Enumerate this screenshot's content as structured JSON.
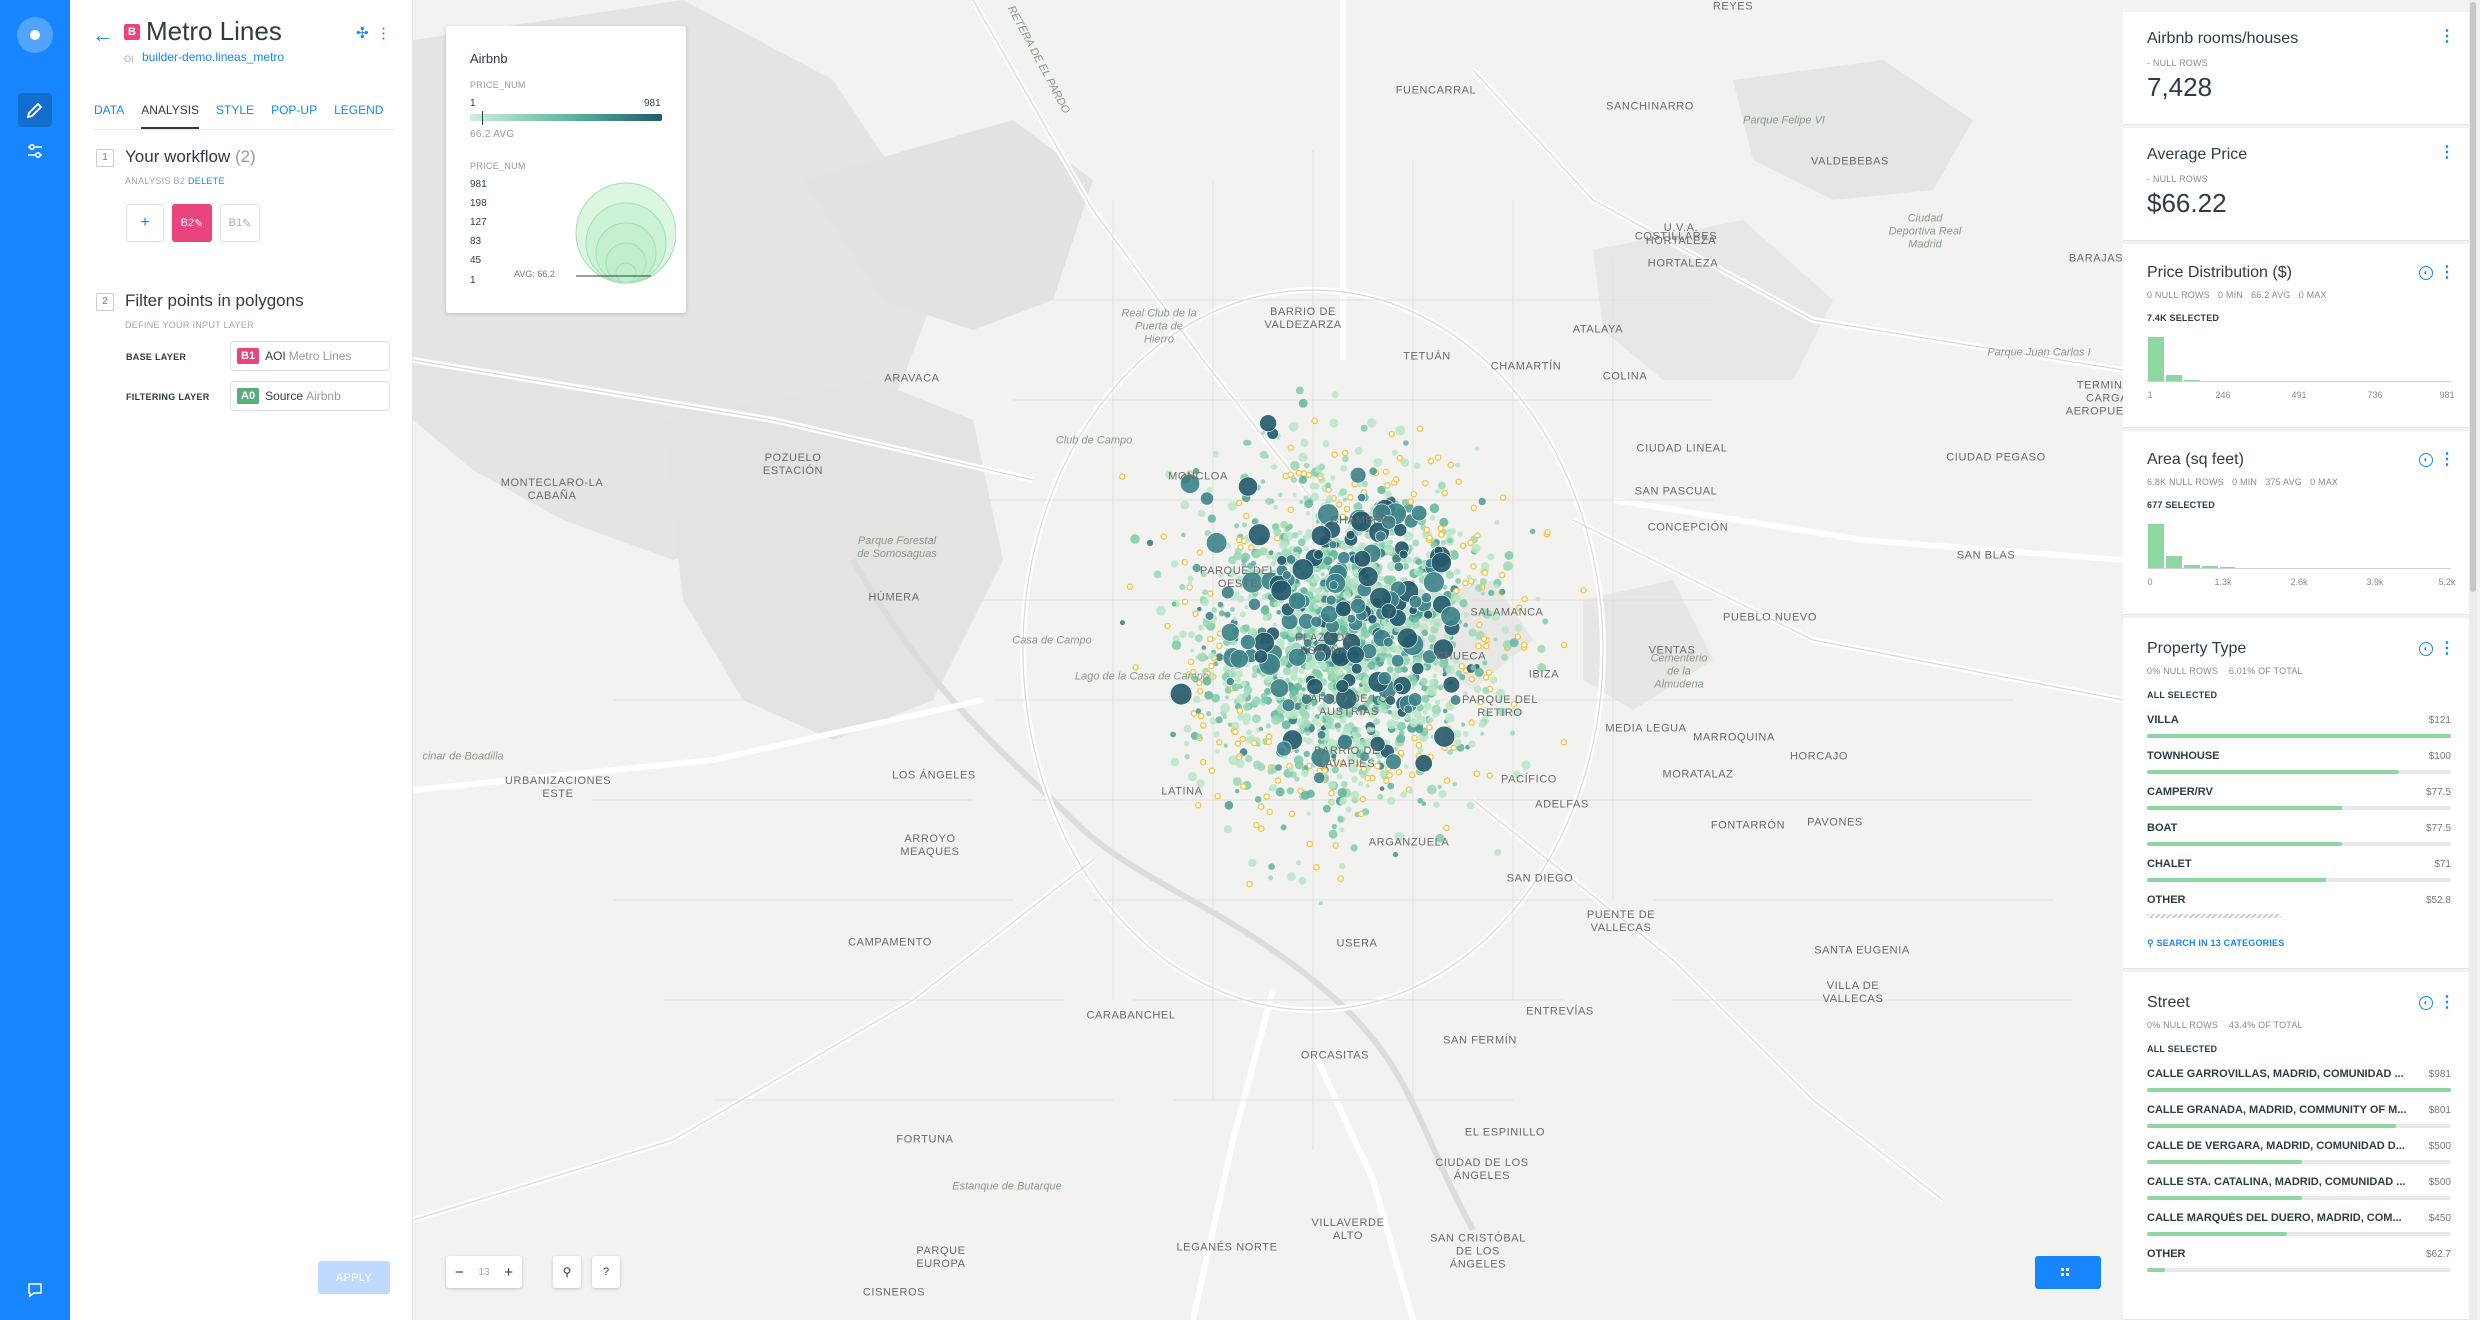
{
  "panel": {
    "badge": "B",
    "title": "Metro Lines",
    "subtitle_prefix": "OI",
    "subtitle": "builder-demo.lineas_metro",
    "tabs": [
      "DATA",
      "ANALYSIS",
      "STYLE",
      "POP-UP",
      "LEGEND"
    ],
    "selected_tab": "ANALYSIS",
    "workflow": {
      "step": "1",
      "title": "Your workflow",
      "count": "(2)",
      "analysis_label": "ANALYSIS B2",
      "delete_label": "DELETE",
      "add_label": "+",
      "node_b2": "B2",
      "node_b1": "B1"
    },
    "filter": {
      "step": "2",
      "title": "Filter points in polygons",
      "subtitle": "DEFINE YOUR INPUT LAYER",
      "base_layer_label": "BASE LAYER",
      "base_badge": "B1",
      "base_name": "AOI",
      "base_source": "Metro Lines",
      "filter_layer_label": "FILTERING LAYER",
      "filter_badge": "A0",
      "filter_name": "Source",
      "filter_source": "Airbnb"
    },
    "apply_label": "APPLY"
  },
  "legend": {
    "title": "Airbnb",
    "field1": "PRICE_NUM",
    "min": "1",
    "max": "981",
    "avg_label": "66.2 AVG",
    "field2": "PRICE_NUM",
    "sizes": [
      "981",
      "198",
      "127",
      "83",
      "45",
      "1"
    ],
    "bubble_avg": "AVG: 66.2"
  },
  "map_controls": {
    "zoom": "13",
    "zoom_out": "−",
    "zoom_in": "+",
    "help": "?"
  },
  "map_labels": [
    {
      "t": "REYES"
    },
    {
      "t": "FUENCARRAL"
    },
    {
      "t": "SANCHINARRO"
    },
    {
      "t": "VALDEBEBAS"
    },
    {
      "t": "COSTILLARES"
    },
    {
      "t": "U.V.A.\nHORTALEZA"
    },
    {
      "t": "HORTALEZA"
    },
    {
      "t": "BARRIO DE\nVALDEZARZA"
    },
    {
      "t": "ATALAYA"
    },
    {
      "t": "TETUÁN"
    },
    {
      "t": "CHAMARTÍN"
    },
    {
      "t": "COLINA"
    },
    {
      "t": "ARAVACA"
    },
    {
      "t": "POZUELO\nESTACIÓN"
    },
    {
      "t": "MONCLOA"
    },
    {
      "t": "CIUDAD LINEAL"
    },
    {
      "t": "CIUDAD PEGASO"
    },
    {
      "t": "TERMINAL\nCARGA\nAEROPUERTO"
    },
    {
      "t": "BARAJAS"
    },
    {
      "t": "MONTECLARO-LA\nCABAÑA"
    },
    {
      "t": "SAN PASCUAL"
    },
    {
      "t": "CHAMBERÍ"
    },
    {
      "t": "CONCEPCIÓN"
    },
    {
      "t": "SAN BLAS"
    },
    {
      "t": "PARQUE DEL\nOESTE"
    },
    {
      "t": "HÚMERA"
    },
    {
      "t": "SALAMANCA"
    },
    {
      "t": "PUEBLO NUEVO"
    },
    {
      "t": "PLAZA DE\nESPAÑA"
    },
    {
      "t": "CHUECA"
    },
    {
      "t": "VENTAS"
    },
    {
      "t": "IBIZA"
    },
    {
      "t": "BARRIO DE LOS\nAUSTRIAS"
    },
    {
      "t": "PARQUE DEL\nRETIRO"
    },
    {
      "t": "MEDIA LEGUA"
    },
    {
      "t": "MARROQUINA"
    },
    {
      "t": "HORCAJO"
    },
    {
      "t": "BARRIO DE\nLAVAPIÉS"
    },
    {
      "t": "URBANIZACIONES\nESTE"
    },
    {
      "t": "LOS ÁNGELES"
    },
    {
      "t": "LATINA"
    },
    {
      "t": "PACÍFICO"
    },
    {
      "t": "MORATALAZ"
    },
    {
      "t": "ADELFAS"
    },
    {
      "t": "ARROYO\nMEAQUES"
    },
    {
      "t": "FONTARRÓN"
    },
    {
      "t": "PAVONES"
    },
    {
      "t": "ARGANZUELA"
    },
    {
      "t": "SAN DIEGO"
    },
    {
      "t": "CAMPAMENTO"
    },
    {
      "t": "PUENTE DE\nVALLECAS"
    },
    {
      "t": "USERA"
    },
    {
      "t": "SANTA EUGENIA"
    },
    {
      "t": "VILLA DE\nVALLECAS"
    },
    {
      "t": "CARABANCHEL"
    },
    {
      "t": "ENTREVÍAS"
    },
    {
      "t": "ORCASITAS"
    },
    {
      "t": "SAN FERMÍN"
    },
    {
      "t": "FORTUNA"
    },
    {
      "t": "EL ESPINILLO"
    },
    {
      "t": "CIUDAD DE LOS\nÁNGELES"
    },
    {
      "t": "VILLAVERDE\nALTO"
    },
    {
      "t": "SAN CRISTÓBAL\nDE LOS\nÁNGELES"
    },
    {
      "t": "PARQUE\nEUROPA"
    },
    {
      "t": "LEGANÉS NORTE"
    },
    {
      "t": "CISNEROS"
    }
  ],
  "park_labels": [
    {
      "t": "Parque Felipe VI"
    },
    {
      "t": "Ciudad\nDeportiva Real\nMadrid"
    },
    {
      "t": "Real Club de la\nPuerta de\nHierro"
    },
    {
      "t": "Parque Juan Carlos I"
    },
    {
      "t": "Club de Campo"
    },
    {
      "t": "Parque Forestal\nde Somosaguas"
    },
    {
      "t": "Casa de Campo"
    },
    {
      "t": "Lago de la Casa de Campo"
    },
    {
      "t": "Cementerio\nde la\nAlmudena"
    },
    {
      "t": "Estanque de Butarque"
    },
    {
      "t": "cinar de Boadilla"
    },
    {
      "t": "RETERA DE EL PARDO"
    }
  ],
  "widgets": {
    "count": {
      "title": "Airbnb rooms/houses",
      "meta": "- NULL ROWS",
      "value": "7,428"
    },
    "avg": {
      "title": "Average Price",
      "meta": "- NULL ROWS",
      "value": "$66.22"
    },
    "price_hist": {
      "title": "Price Distribution ($)",
      "meta": [
        "0 NULL ROWS",
        "0 MIN",
        "66.2 AVG",
        "0 MAX"
      ],
      "selected": "7.4K SELECTED",
      "bins": [
        1.0,
        0.16,
        0.05,
        0.03,
        0.02,
        0.01,
        0.01,
        0.01,
        0.01,
        0.01,
        0.01,
        0.01,
        0.02,
        0.02,
        0.02,
        0.02,
        0.02
      ],
      "ticks": [
        "1",
        "246",
        "491",
        "736",
        "981"
      ]
    },
    "area_hist": {
      "title": "Area (sq feet)",
      "meta": [
        "6.8K NULL ROWS",
        "0 MIN",
        "375 AVG",
        "0 MAX"
      ],
      "selected": "677 SELECTED",
      "bins": [
        1.0,
        0.3,
        0.1,
        0.06,
        0.04,
        0.02,
        0.02,
        0.01,
        0.01,
        0.01,
        0.01,
        0.01,
        0.01,
        0.01,
        0.01,
        0.01,
        0.01
      ],
      "ticks": [
        "0",
        "1.3k",
        "2.6k",
        "3.9k",
        "5.2k"
      ]
    },
    "property": {
      "title": "Property Type",
      "meta": [
        "0% NULL ROWS",
        "6.01% OF TOTAL"
      ],
      "selected": "ALL SELECTED",
      "items": [
        {
          "name": "VILLA",
          "value": "$121",
          "fill": 1.0
        },
        {
          "name": "TOWNHOUSE",
          "value": "$100",
          "fill": 0.83
        },
        {
          "name": "CAMPER/RV",
          "value": "$77.5",
          "fill": 0.64
        },
        {
          "name": "BOAT",
          "value": "$77.5",
          "fill": 0.64
        },
        {
          "name": "CHALET",
          "value": "$71",
          "fill": 0.59
        },
        {
          "name": "OTHER",
          "value": "$52.8",
          "fill": 0.44
        }
      ],
      "search": "SEARCH IN 13 CATEGORIES"
    },
    "street": {
      "title": "Street",
      "meta": [
        "0% NULL ROWS",
        "43.4% OF TOTAL"
      ],
      "selected": "ALL SELECTED",
      "items": [
        {
          "name": "CALLE GARROVILLAS, MADRID, COMUNIDAD ...",
          "value": "$981",
          "fill": 1.0
        },
        {
          "name": "CALLE GRANADA, MADRID, COMMUNITY OF M...",
          "value": "$801",
          "fill": 0.82
        },
        {
          "name": "CALLE DE VERGARA, MADRID, COMUNIDAD D...",
          "value": "$500",
          "fill": 0.51
        },
        {
          "name": "CALLE STA. CATALINA, MADRID, COMUNIDAD ...",
          "value": "$500",
          "fill": 0.51
        },
        {
          "name": "CALLE MARQUÉS DEL DUERO, MADRID, COM...",
          "value": "$450",
          "fill": 0.46
        },
        {
          "name": "OTHER",
          "value": "$62.7",
          "fill": 0.06
        }
      ]
    }
  },
  "colors": {
    "accent": "#1785fb",
    "badge_b": "#e9447d",
    "badge_a": "#5aad7a",
    "histogram": "#8ed6a2",
    "dot_dark": "#1f5c6b",
    "dot_light": "#b8e6c7",
    "dot_yellow": "#f3c64a"
  }
}
